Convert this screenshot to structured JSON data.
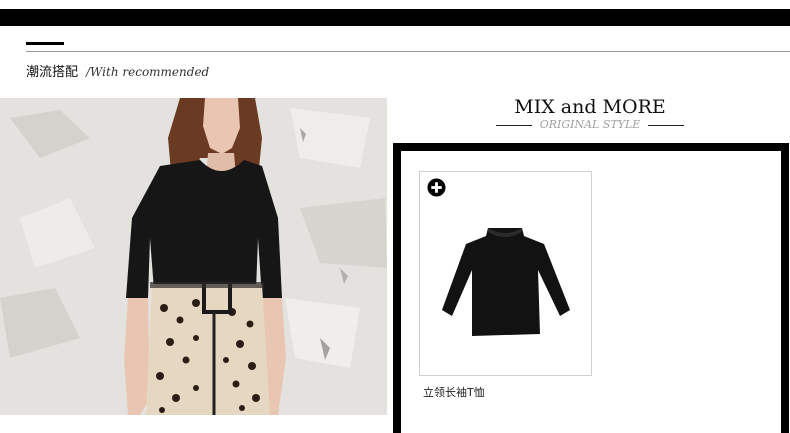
{
  "section": {
    "title_cn": "潮流搭配",
    "title_en": "/With recommended"
  },
  "mix": {
    "title": "MIX and MORE",
    "subtitle": "ORIGINAL STYLE"
  },
  "product": {
    "name": "立领长袖T恤",
    "add_icon": "plus-circle-icon",
    "image": "black-tshirt"
  },
  "model_photo": {
    "subject": "model-black-top-leopard-skirt"
  },
  "colors": {
    "bar": "#000000",
    "subtitle": "#a0a0a0",
    "card_border": "#cfcfcf"
  }
}
